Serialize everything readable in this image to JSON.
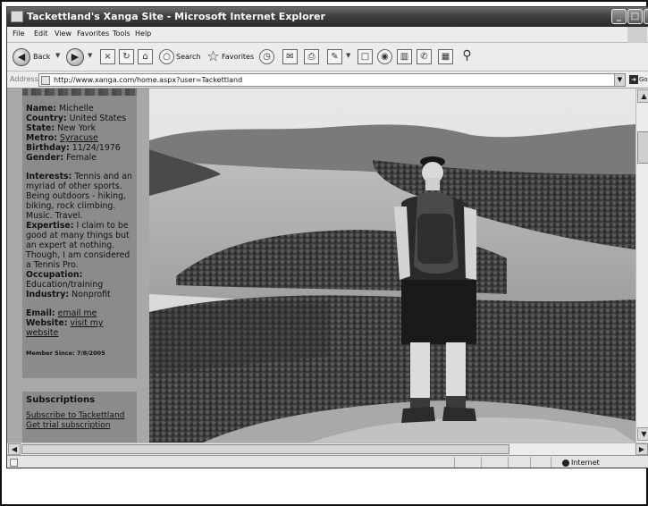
{
  "window": {
    "title": "Tackettland's Xanga Site - Microsoft Internet Explorer",
    "controls": {
      "minimize": "_",
      "maximize": "□",
      "close": "✕"
    }
  },
  "menu": [
    "File",
    "Edit",
    "View",
    "Favorites",
    "Tools",
    "Help"
  ],
  "toolbar": {
    "back_label": "Back",
    "search_label": "Search",
    "favorites_label": "Favorites",
    "icons": [
      "back-icon",
      "forward-icon",
      "stop-icon",
      "refresh-icon",
      "home-icon",
      "search-icon",
      "favorites-icon",
      "history-icon",
      "mail-icon",
      "print-icon",
      "edit-icon",
      "discuss-icon",
      "messenger-icon",
      "research-icon",
      "reference-icon",
      "media-icon",
      "accessibility-icon"
    ]
  },
  "address": {
    "label": "Address",
    "url": "http://www.xanga.com/home.aspx?user=Tackettland",
    "go_label": "Go"
  },
  "profile": {
    "name_label": "Name:",
    "name": "Michelle",
    "country_label": "Country:",
    "country": "United States",
    "state_label": "State:",
    "state": "New York",
    "metro_label": "Metro:",
    "metro": "Syracuse",
    "birthday_label": "Birthday:",
    "birthday": "11/24/1976",
    "gender_label": "Gender:",
    "gender": "Female",
    "interests_label": "Interests:",
    "interests_lines": [
      "Tennis and an",
      "myriad of other sports.",
      "Being outdoors - hiking,",
      "biking, rock climbing.",
      "Music. Travel."
    ],
    "expertise_label": "Expertise:",
    "expertise_lines": [
      "I claim to be",
      "good at many things but",
      "an expert at nothing.",
      "Though, I am considered",
      "a Tennis Pro."
    ],
    "occupation_label": "Occupation:",
    "occupation": "Education/training",
    "industry_label": "Industry:",
    "industry": "Nonprofit",
    "email_label": "Email:",
    "email_link": "email me",
    "website_label": "Website:",
    "website_link_1": "visit my",
    "website_link_2": "website",
    "member_since": "Member Since: 7/8/2005"
  },
  "subscriptions": {
    "title": "Subscriptions",
    "subscribe_link": "Subscribe to Tackettland",
    "trial_link": "Get trial subscription"
  },
  "status": {
    "zone": "Internet"
  },
  "colors": {
    "titlebar": "#3f3f3f",
    "panel": "#8b8b8b",
    "page_bg": "#a8a8a8"
  }
}
